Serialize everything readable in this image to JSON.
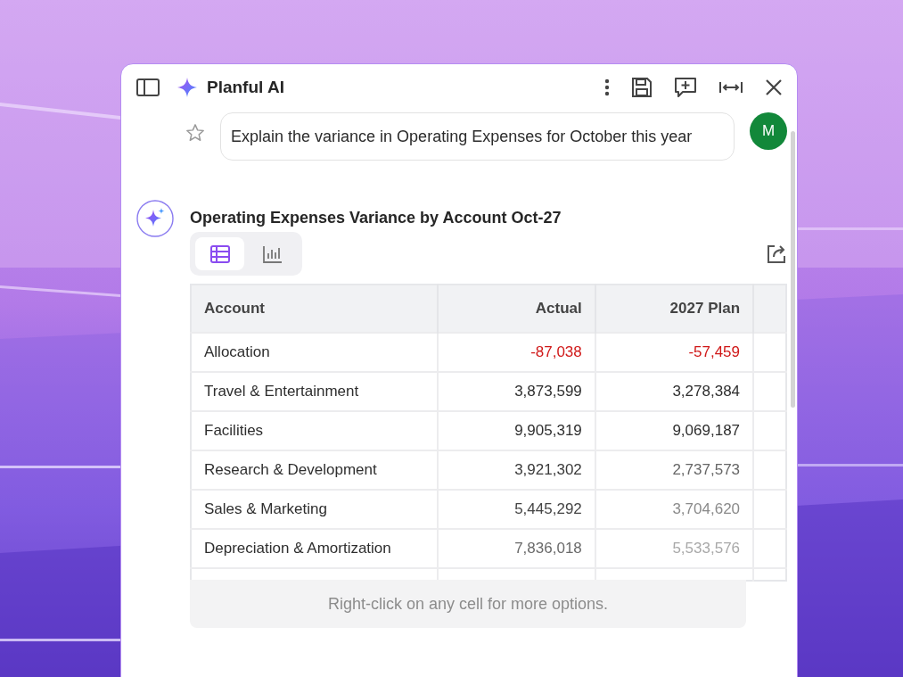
{
  "window": {
    "title": "Planful AI"
  },
  "prompt": {
    "text": "Explain the variance in Operating Expenses for October this year",
    "avatar": "M"
  },
  "response": {
    "title": "Operating Expenses Variance by Account Oct-27",
    "views": [
      {
        "kind": "table",
        "selected": true
      },
      {
        "kind": "chart",
        "selected": false
      }
    ],
    "table": {
      "columns": [
        "Account",
        "Actual",
        "2027 Plan"
      ],
      "rows": [
        {
          "account": "Allocation",
          "actual": "-87,038",
          "plan": "-57,459",
          "negative": true
        },
        {
          "account": "Travel & Entertainment",
          "actual": "3,873,599",
          "plan": "3,278,384",
          "negative": false
        },
        {
          "account": "Facilities",
          "actual": "9,905,319",
          "plan": "9,069,187",
          "negative": false
        },
        {
          "account": "Research & Development",
          "actual": "3,921,302",
          "plan": "2,737,573",
          "negative": false
        },
        {
          "account": "Sales & Marketing",
          "actual": "5,445,292",
          "plan": "3,704,620",
          "negative": false
        },
        {
          "account": "Depreciation & Amortization",
          "actual": "7,836,018",
          "plan": "5,533,576",
          "negative": false
        }
      ]
    },
    "hint": "Right-click on any cell for more options."
  }
}
